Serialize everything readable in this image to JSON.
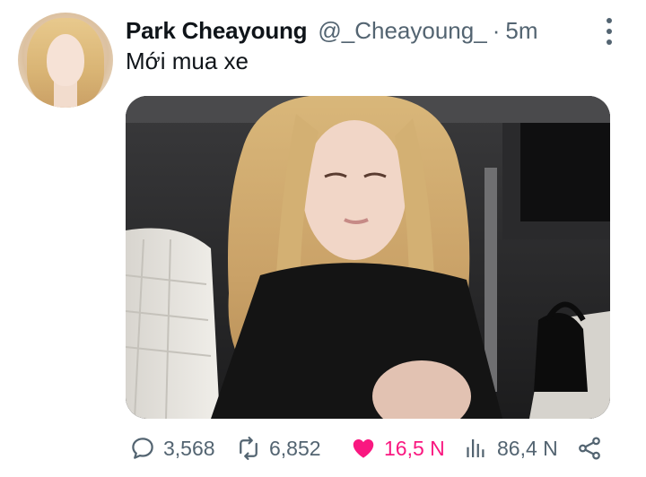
{
  "tweet": {
    "author_name": "Park Cheayoung",
    "handle": "@_Cheayoung_",
    "separator": "·",
    "time": "5m",
    "text": "Mới mua xe",
    "avatar_icon": "profile-photo",
    "more_icon": "more-vertical-icon",
    "media_description_icon": "photo"
  },
  "actions": {
    "reply": {
      "icon": "comment-icon",
      "count": "3,568"
    },
    "retweet": {
      "icon": "retweet-icon",
      "count": "6,852"
    },
    "like": {
      "icon": "heart-filled-icon",
      "count": "16,5 N",
      "color": "#f91880"
    },
    "views": {
      "icon": "analytics-icon",
      "count": "86,4 N"
    },
    "share": {
      "icon": "share-icon"
    }
  },
  "colors": {
    "text_primary": "#0f1419",
    "text_secondary": "#536471",
    "like": "#f91880"
  }
}
